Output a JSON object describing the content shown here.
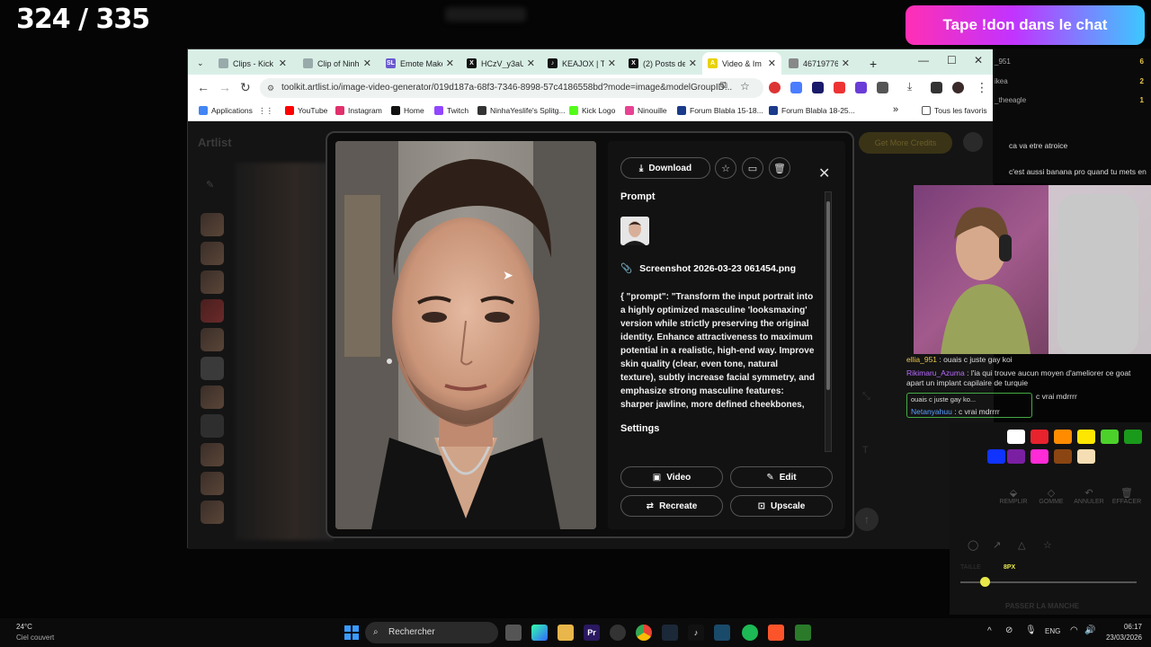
{
  "overlay": {
    "counter": "324 / 335",
    "banner": "Tape !don dans le chat"
  },
  "browser": {
    "tabs": [
      {
        "label": "Clips - Kick",
        "icon_color": "#9aa"
      },
      {
        "label": "Clip of Ninh",
        "icon_color": "#9aa"
      },
      {
        "label": "Emote Make",
        "icon_color": "#6a5acd",
        "icon_text": "SL"
      },
      {
        "label": "HCzV_y3aU",
        "icon_color": "#111",
        "icon_text": "X"
      },
      {
        "label": "KEAJOX | Te",
        "icon_color": "#111",
        "icon_text": "♪"
      },
      {
        "label": "(2) Posts de",
        "icon_color": "#111",
        "icon_text": "X"
      },
      {
        "label": "Video & Im",
        "icon_color": "#e8d200",
        "icon_text": "A"
      },
      {
        "label": "467197761",
        "icon_color": "#888"
      }
    ],
    "new_tab": "+",
    "url": "toolkit.artlist.io/image-video-generator/019d187a-68f3-7346-8998-57c4186558bd?mode=image&modelGroupID...",
    "bookmarks": [
      {
        "label": "Applications",
        "color": "#4285f4"
      },
      {
        "label": "YouTube",
        "color": "#f00"
      },
      {
        "label": "Instagram",
        "color": "#e1306c"
      },
      {
        "label": "Home",
        "color": "#111"
      },
      {
        "label": "Twitch",
        "color": "#9146ff"
      },
      {
        "label": "NinhaYeslife's Splitg...",
        "color": "#333"
      },
      {
        "label": "Kick Logo",
        "color": "#53fc18"
      },
      {
        "label": "Ninouille",
        "color": "#e84393"
      },
      {
        "label": "Forum Blabla 15-18...",
        "color": "#1a3a8a"
      },
      {
        "label": "Forum Blabla 18-25...",
        "color": "#1a3a8a"
      }
    ],
    "all_favorites": "Tous les favoris"
  },
  "app": {
    "logo": "Artlist",
    "credits_button": "Get More Credits"
  },
  "modal": {
    "download_label": "Download",
    "prompt_heading": "Prompt",
    "file_name": "Screenshot 2026-03-23 061454.png",
    "prompt_text": "{ \"prompt\": \"Transform the input portrait into a highly optimized masculine 'looksmaxing' version while strictly preserving the original identity. Enhance attractiveness to maximum potential in a realistic, high-end way. Improve skin quality (clear, even tone, natural texture), subtly increase facial symmetry, and emphasize strong masculine features: sharper jawline, more defined cheekbones,",
    "settings_heading": "Settings",
    "video_label": "Video",
    "edit_label": "Edit",
    "recreate_label": "Recreate",
    "upscale_label": "Upscale"
  },
  "chat": {
    "top_users": [
      {
        "name": "_951",
        "count": "6"
      },
      {
        "name": "ikea",
        "count": "2"
      },
      {
        "name": "_theeagle",
        "count": "1"
      }
    ],
    "upper_lines": [
      "ca va etre atroice",
      "c'est aussi banana pro quand tu mets en"
    ],
    "messages": [
      {
        "user": "ellia_951",
        "text": "ouais c juste gay koi",
        "color": "#e8c84a"
      },
      {
        "user": "Rikimaru_Azuma",
        "text": "l'ia qui trouve aucun moyen d'ameliorer ce goat apart un implant capilaire de turquie",
        "color": "#b86bff"
      },
      {
        "user": "ellia_951",
        "text": "ouais c juste gay ko...",
        "color": "#dddddd"
      },
      {
        "user": "Netanyahuu",
        "text": "c vrai mdrrrr",
        "color": "#5aa0ff"
      }
    ],
    "reply_tail": "c vrai mdrrrr"
  },
  "draw": {
    "colors": [
      "#ffffff",
      "#e8232d",
      "#ff8c00",
      "#ffe600",
      "#4cd12b",
      "#1a9a1a",
      "#1033ff",
      "#7a1fa2",
      "#ff2bd6",
      "#8b4513",
      "#f5deb3"
    ],
    "tools": [
      "REMPLIR",
      "GOMME",
      "ANNULER",
      "EFFACER"
    ],
    "size_label": "TAILLE",
    "size_value": "8PX",
    "pass_label": "PASSER LA MANCHE"
  },
  "taskbar": {
    "weather_temp": "24°C",
    "weather_desc": "Ciel couvert",
    "search_placeholder": "Rechercher",
    "lang": "ENG",
    "time": "06:17",
    "date": "23/03/2026"
  }
}
